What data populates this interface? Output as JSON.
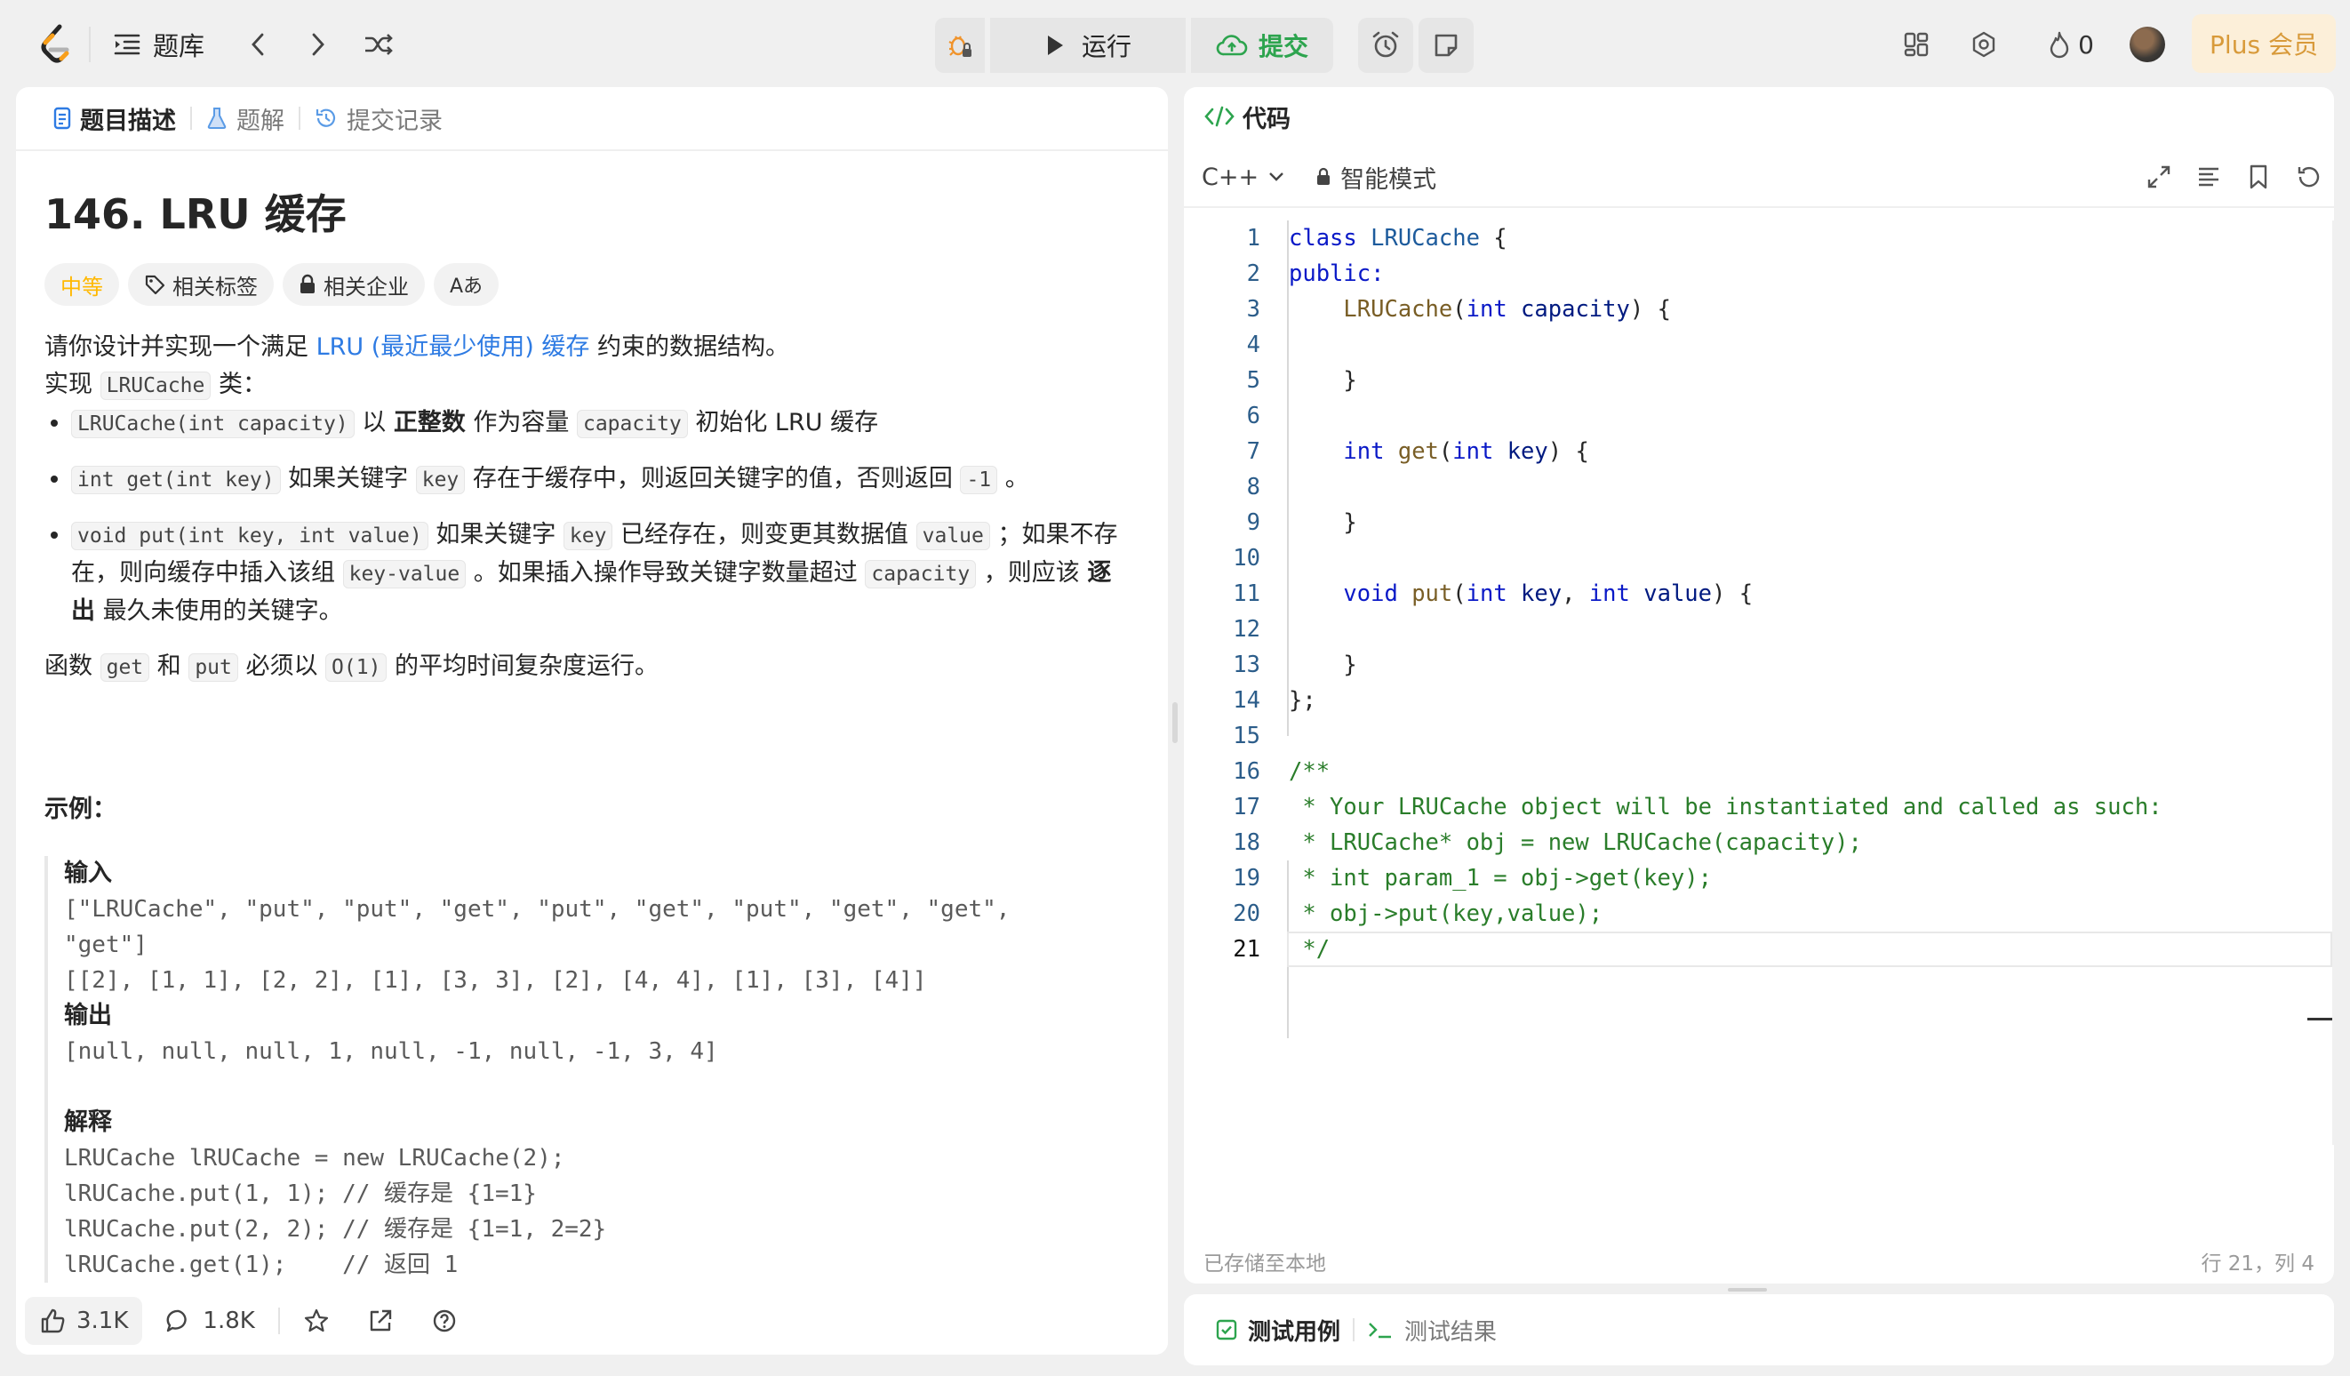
{
  "topbar": {
    "problem_list_label": "题库",
    "run_label": "运行",
    "submit_label": "提交",
    "streak_count": "0",
    "plus_label": "Plus 会员"
  },
  "left": {
    "tabs": [
      "题目描述",
      "题解",
      "提交记录"
    ],
    "title": "146. LRU 缓存",
    "tags": {
      "difficulty": "中等",
      "related_tags": "相关标签",
      "related_companies": "相关企业",
      "font_toggle": "Aあ"
    },
    "desc": {
      "p1_prefix": "请你设计并实现一个满足 ",
      "p1_link": "LRU (最近最少使用) 缓存",
      "p1_suffix": " 约束的数据结构。",
      "p2_prefix": "实现 ",
      "p2_code": "LRUCache",
      "p2_suffix": " 类：",
      "b1_code": "LRUCache(int capacity)",
      "b1_t1": " 以 ",
      "b1_bold": "正整数",
      "b1_t2": " 作为容量 ",
      "b1_code2": "capacity",
      "b1_t3": " 初始化 LRU 缓存",
      "b2_code": "int get(int key)",
      "b2_t1": " 如果关键字 ",
      "b2_code2": "key",
      "b2_t2": " 存在于缓存中，则返回关键字的值，否则返回 ",
      "b2_code3": "-1",
      "b2_t3": " 。",
      "b3_code": "void put(int key, int value)",
      "b3_t1": " 如果关键字 ",
      "b3_code2": "key",
      "b3_t2": " 已经存在，则变更其数据值 ",
      "b3_code3": "value",
      "b3_t3": " ；如果不存在，则向缓存中插入该组 ",
      "b3_code4": "key-value",
      "b3_t4": " 。如果插入操作导致关键字数量超过 ",
      "b3_code5": "capacity",
      "b3_t5": " ，则应该 ",
      "b3_bold": "逐出",
      "b3_t6": " 最久未使用的关键字。",
      "p3_t1": "函数 ",
      "p3_c1": "get",
      "p3_t2": " 和 ",
      "p3_c2": "put",
      "p3_t3": " 必须以 ",
      "p3_c3": "O(1)",
      "p3_t4": " 的平均时间复杂度运行。"
    },
    "example": {
      "heading": "示例：",
      "input_label": "输入",
      "input_lines": [
        "[\"LRUCache\", \"put\", \"put\", \"get\", \"put\", \"get\", \"put\", \"get\", \"get\",",
        "\"get\"]",
        "[[2], [1, 1], [2, 2], [1], [3, 3], [2], [4, 4], [1], [3], [4]]"
      ],
      "output_label": "输出",
      "output_line": "[null, null, null, 1, null, -1, null, -1, 3, 4]",
      "explain_label": "解释",
      "explain_lines": [
        "LRUCache lRUCache = new LRUCache(2);",
        "lRUCache.put(1, 1); // 缓存是 {1=1}",
        "lRUCache.put(2, 2); // 缓存是 {1=1, 2=2}",
        "lRUCache.get(1);    // 返回 1"
      ]
    },
    "footer": {
      "likes": "3.1K",
      "comments": "1.8K"
    }
  },
  "code": {
    "header": "代码",
    "language": "C++",
    "mode": "智能模式",
    "status_left": "已存储至本地",
    "status_right": "行 21，列 4",
    "line_numbers": [
      "1",
      "2",
      "3",
      "4",
      "5",
      "6",
      "7",
      "8",
      "9",
      "10",
      "11",
      "12",
      "13",
      "14",
      "15",
      "16",
      "17",
      "18",
      "19",
      "20",
      "21"
    ],
    "lines": {
      "l1_kw": "class",
      "l1_cls": "LRUCache",
      "l1_rest": " {",
      "l2_kw": "public:",
      "l3_fn": "LRUCache",
      "l3_p1": "(",
      "l3_kw": "int",
      "l3_prm": "capacity",
      "l3_rest": ") {",
      "l5": "}",
      "l7_kw": "int",
      "l7_fn": "get",
      "l7_p1": "(",
      "l7_kw2": "int",
      "l7_prm": "key",
      "l7_rest": ") {",
      "l9": "}",
      "l11_kw": "void",
      "l11_fn": "put",
      "l11_p1": "(",
      "l11_kw2": "int",
      "l11_prm": "key",
      "l11_c": ", ",
      "l11_kw3": "int",
      "l11_prm2": "value",
      "l11_rest": ") {",
      "l13": "}",
      "l14": "};",
      "l16": "/**",
      "l17": " * Your LRUCache object will be instantiated and called as such:",
      "l18": " * LRUCache* obj = new LRUCache(capacity);",
      "l19": " * int param_1 = obj->get(key);",
      "l20": " * obj->put(key,value);",
      "l21": " */"
    }
  },
  "bottom": {
    "tabs": [
      "测试用例",
      "测试结果"
    ]
  },
  "colors": {
    "accent_link": "#2e7be3",
    "submit_green": "#2da44e",
    "difficulty_medium": "#ffb800",
    "plus_gold": "#d89a3a"
  }
}
